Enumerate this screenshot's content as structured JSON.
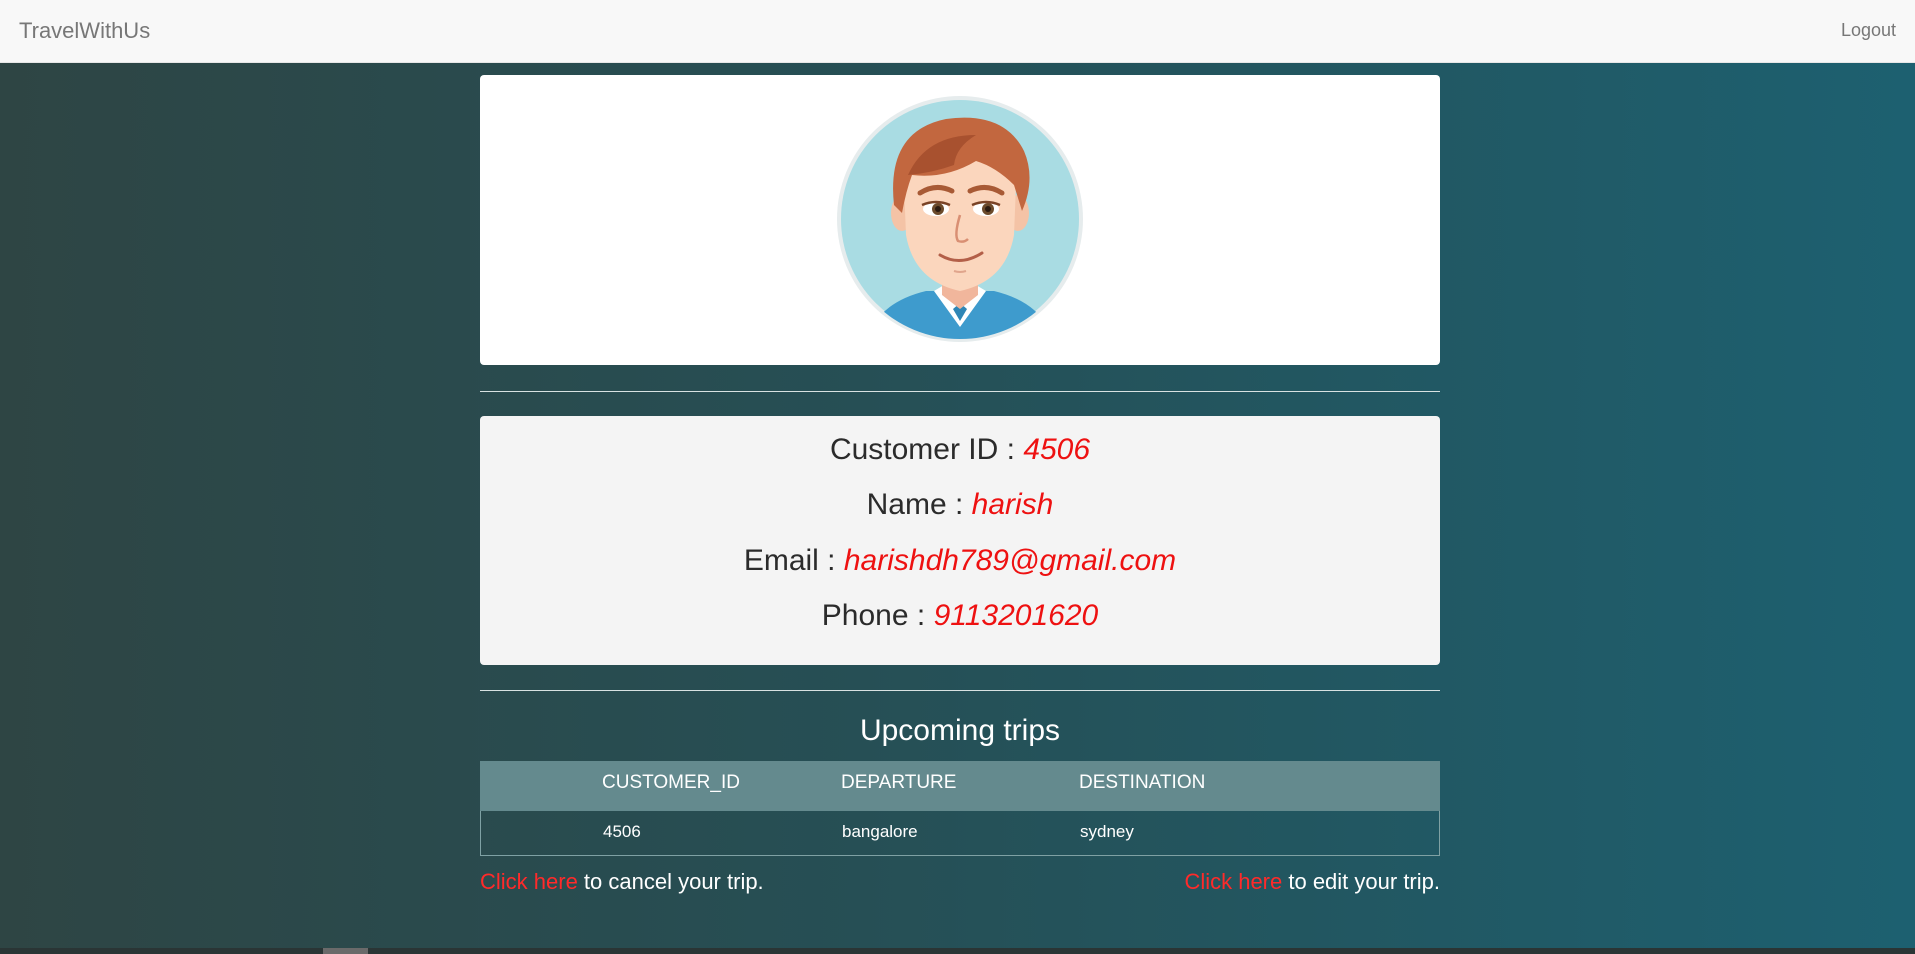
{
  "navbar": {
    "brand": "TravelWithUs",
    "logout": "Logout"
  },
  "profile": {
    "customer_id_label": "Customer ID : ",
    "customer_id": "4506",
    "name_label": "Name : ",
    "name": "harish",
    "email_label": "Email : ",
    "email": "harishdh789@gmail.com",
    "phone_label": "Phone : ",
    "phone": "9113201620"
  },
  "trips": {
    "title": "Upcoming trips",
    "columns": [
      "CUSTOMER_ID",
      "DEPARTURE",
      "DESTINATION"
    ],
    "rows": [
      [
        "4506",
        "bangalore",
        "sydney"
      ]
    ]
  },
  "footer": {
    "cancel_link": "Click here",
    "cancel_text": " to cancel your trip.",
    "edit_link": "Click here",
    "edit_text": " to edit your trip."
  },
  "colors": {
    "accent_red": "#ff2a2a",
    "value_red": "#ee1111",
    "navbar_bg": "#f8f8f8"
  }
}
